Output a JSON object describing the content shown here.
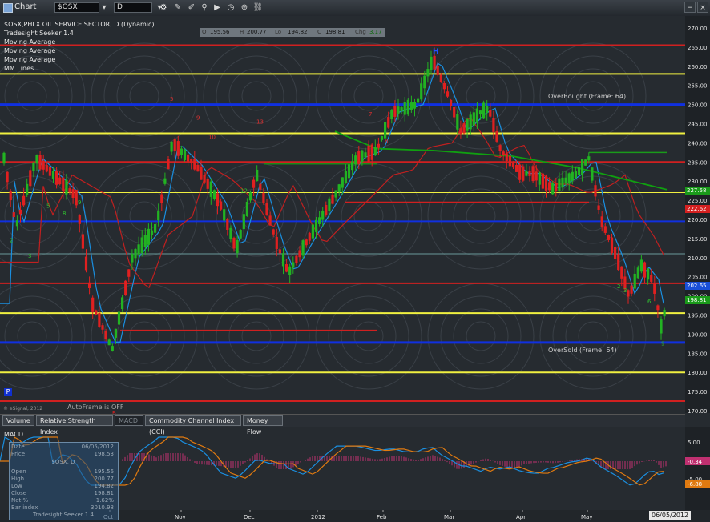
{
  "toolbar": {
    "title": "Chart",
    "symbol": "$OSX",
    "interval": "D",
    "buttons": [
      "settings",
      "pencil",
      "marker",
      "play",
      "alert",
      "link"
    ],
    "window_buttons": [
      "−",
      "×"
    ]
  },
  "chart": {
    "heading_lines": [
      "$OSX,PHLX OIL SERVICE SECTOR, D (Dynamic)",
      "Tradesight Seeker 1.4",
      "Moving Average",
      "Moving Average",
      "Moving Average",
      "MM Lines"
    ],
    "ohlc_labels": [
      "O",
      "H",
      "Lo",
      "C",
      "Chg"
    ],
    "ohlc_values": [
      "195.56",
      "200.77",
      "194.82",
      "198.81",
      "3.17"
    ],
    "annotation_overbought": "OverBought (Frame: 64)",
    "annotation_oversold": "OverSold (Frame: 64)",
    "autoframe": "AutoFrame is OFF",
    "copyright": "© eSignal, 2012",
    "marker_H": "H",
    "marker_P": "P",
    "marker_B": "B",
    "price_axis_labels": [
      "270.00",
      "265.00",
      "260.00",
      "255.00",
      "250.00",
      "245.00",
      "240.00",
      "235.00",
      "230.00",
      "225.00",
      "220.00",
      "215.00",
      "210.00",
      "205.00",
      "200.00",
      "195.00",
      "190.00",
      "185.00",
      "180.00",
      "175.00",
      "170.00"
    ],
    "price_tags": [
      {
        "text": "227.58",
        "color": "#1a9a1a"
      },
      {
        "text": "222.62",
        "color": "#d42020"
      },
      {
        "text": "202.65",
        "color": "#1a50d8"
      },
      {
        "text": "198.81",
        "color": "#1a9a1a"
      }
    ]
  },
  "tabs": [
    "Volume",
    "Relative Strength Index",
    "MACD",
    "Commodity Channel Index (CCI)",
    "Money Flow"
  ],
  "active_tab": "MACD",
  "macd": {
    "title": "MACD",
    "axis_labels": [
      "5.00",
      "0.00",
      "-5.00"
    ],
    "tags": [
      {
        "text": "-0.34",
        "color": "#c03070"
      },
      {
        "text": "-6.88",
        "color": "#e07a10"
      }
    ]
  },
  "data_window": {
    "rows": [
      {
        "label": "Date",
        "value": "06/05/2012"
      },
      {
        "label": "Price",
        "value": "198.53"
      },
      {
        "label": "",
        "value": "$OSX, D"
      },
      {
        "label": "Open",
        "value": "195.56"
      },
      {
        "label": "High",
        "value": "200.77"
      },
      {
        "label": "Low",
        "value": "194.82"
      },
      {
        "label": "Close",
        "value": "198.81"
      },
      {
        "label": "Net %",
        "value": "1.62%"
      },
      {
        "label": "Bar index",
        "value": "3010.98"
      },
      {
        "label": "",
        "value": "Tradesight Seeker 1.4"
      }
    ]
  },
  "x_axis": {
    "labels": [
      "Oct",
      "Nov",
      "Dec",
      "2012",
      "Feb",
      "Mar",
      "Apr",
      "May"
    ],
    "current_date": "06/05/2012"
  },
  "colors": {
    "up_candle": "#22b322",
    "down_candle": "#e02020",
    "blue_line": "#1030e0",
    "red_line": "#d02020",
    "yellow_line": "#f0f040",
    "green_ma": "#10a010",
    "background": "#262b30"
  }
}
